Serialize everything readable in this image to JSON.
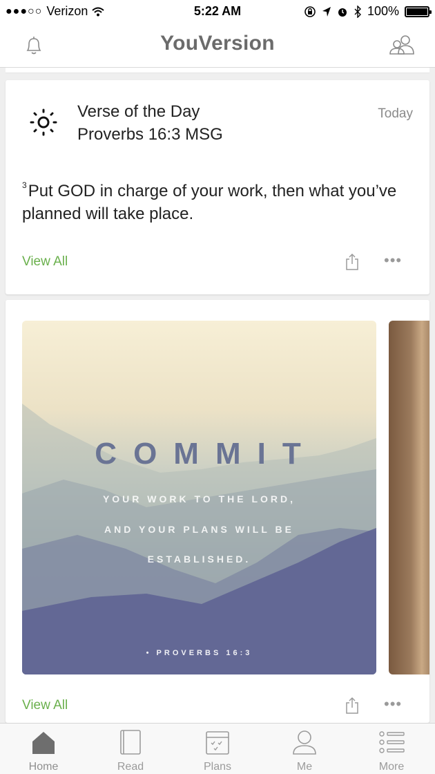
{
  "status": {
    "carrier": "Verizon",
    "time": "5:22 AM",
    "battery": "100%"
  },
  "header": {
    "title": "YouVersion",
    "left_icon": "bell-icon",
    "right_icon": "friends-icon"
  },
  "verse_card": {
    "title": "Verse of the Day",
    "reference": "Proverbs 16:3 MSG",
    "date": "Today",
    "verse_number": "3",
    "verse_text": "Put GOD in charge of your work, then what you’ve planned will take place.",
    "view_all": "View All"
  },
  "image_card": {
    "headline": "COMMIT",
    "line1": "YOUR WORK TO THE LORD,",
    "line2": "AND YOUR PLANS WILL BE",
    "line3": "ESTABLISHED.",
    "reference": "• PROVERBS 16:3",
    "view_all": "View All"
  },
  "tabs": [
    {
      "label": "Home",
      "icon": "home-icon"
    },
    {
      "label": "Read",
      "icon": "book-icon"
    },
    {
      "label": "Plans",
      "icon": "plans-icon"
    },
    {
      "label": "Me",
      "icon": "person-icon"
    },
    {
      "label": "More",
      "icon": "more-list-icon"
    }
  ],
  "colors": {
    "accent_green": "#6ab04c",
    "header_text": "#6b6b6b",
    "commit_text": "#6a7494"
  }
}
